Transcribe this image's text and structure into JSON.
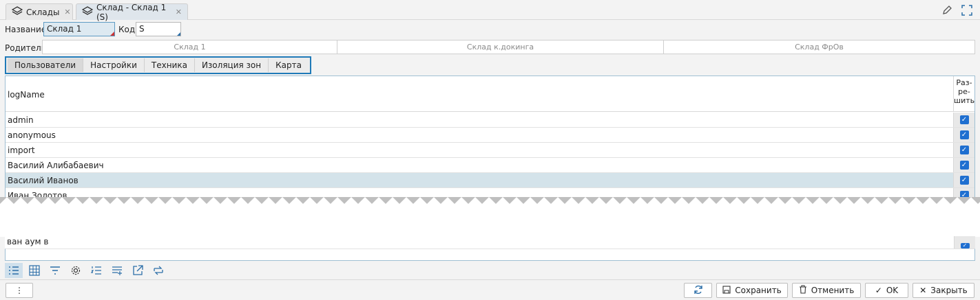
{
  "tabs": [
    {
      "label": "Склады",
      "icon": "layers-icon"
    },
    {
      "label": "Склад - Склад 1 (S)",
      "icon": "layers-icon"
    }
  ],
  "form": {
    "name_label": "Название",
    "name_value": "Склад 1",
    "code_label": "Код",
    "code_value": "S",
    "parent_label": "Родитель",
    "parent_cells": [
      "Склад 1",
      "Склад к.докинга",
      "Склад ФрОв"
    ]
  },
  "subtabs": [
    "Пользователи",
    "Настройки",
    "Техника",
    "Изоляция зон",
    "Карта"
  ],
  "grid": {
    "col_name": "logName",
    "col_perm": "Раз-\nре-\nшить",
    "rows": [
      {
        "name": "admin",
        "allowed": true
      },
      {
        "name": "anonymous",
        "allowed": true
      },
      {
        "name": "import",
        "allowed": true
      },
      {
        "name": "Василий Алибабаевич",
        "allowed": true
      },
      {
        "name": "Василий Иванов",
        "allowed": true
      },
      {
        "name": "Иван Золотов",
        "allowed": true
      }
    ],
    "partial_row": "ван аум в"
  },
  "footer": {
    "menu_label": "⋮",
    "refresh_icon": "refresh-icon",
    "save_label": "Сохранить",
    "cancel_label": "Отменить",
    "ok_label": "OK",
    "close_label": "Закрыть"
  }
}
